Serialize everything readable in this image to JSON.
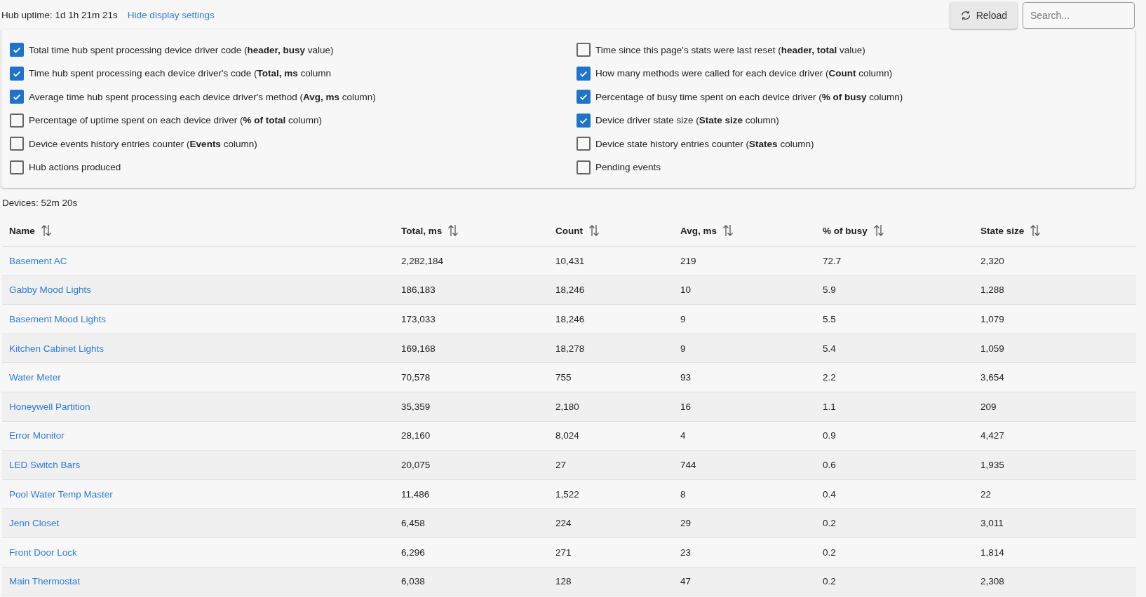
{
  "header": {
    "uptime": "Hub uptime: 1d 1h 21m 21s",
    "toggle_link": "Hide display settings",
    "reload_button": "Reload",
    "search": {
      "placeholder": "Search..."
    }
  },
  "settings": [
    {
      "label": "Total time hub spent processing device driver code (**header, busy** value)",
      "checked": true
    },
    {
      "label": "Time since this page's stats were last reset (**header, total** value)",
      "checked": false
    },
    {
      "label": "Time hub spent processing each device driver's code (**Total, ms** column",
      "checked": true
    },
    {
      "label": "How many methods were called for each device driver (**Count** column)",
      "checked": true
    },
    {
      "label": "Average time hub spent processing each device driver's method (**Avg, ms** column)",
      "checked": true
    },
    {
      "label": "Percentage of busy time spent on each device driver (**% of busy** column)",
      "checked": true
    },
    {
      "label": "Percentage of uptime spent on each device driver (**% of total** column)",
      "checked": false
    },
    {
      "label": "Device driver state size (**State size** column)",
      "checked": true
    },
    {
      "label": "Device events history entries counter (**Events** column)",
      "checked": false
    },
    {
      "label": "Device state history entries counter (**States** column)",
      "checked": false
    },
    {
      "label": "Hub actions produced",
      "checked": false
    },
    {
      "label": "Pending events",
      "checked": false
    }
  ],
  "devices_summary": "Devices: 52m 20s",
  "table": {
    "columns": [
      "Name",
      "Total, ms",
      "Count",
      "Avg, ms",
      "% of busy",
      "State size"
    ],
    "rows": [
      [
        "Basement AC",
        "2,282,184",
        "10,431",
        "219",
        "72.7",
        "2,320"
      ],
      [
        "Gabby Mood Lights",
        "186,183",
        "18,246",
        "10",
        "5.9",
        "1,288"
      ],
      [
        "Basement Mood Lights",
        "173,033",
        "18,246",
        "9",
        "5.5",
        "1,079"
      ],
      [
        "Kitchen Cabinet Lights",
        "169,168",
        "18,278",
        "9",
        "5.4",
        "1,059"
      ],
      [
        "Water Meter",
        "70,578",
        "755",
        "93",
        "2.2",
        "3,654"
      ],
      [
        "Honeywell Partition",
        "35,359",
        "2,180",
        "16",
        "1.1",
        "209"
      ],
      [
        "Error Monitor",
        "28,160",
        "8,024",
        "4",
        "0.9",
        "4,427"
      ],
      [
        "LED Switch Bars",
        "20,075",
        "27",
        "744",
        "0.6",
        "1,935"
      ],
      [
        "Pool Water Temp Master",
        "11,486",
        "1,522",
        "8",
        "0.4",
        "22"
      ],
      [
        "Jenn Closet",
        "6,458",
        "224",
        "29",
        "0.2",
        "3,011"
      ],
      [
        "Front Door Lock",
        "6,296",
        "271",
        "23",
        "0.2",
        "1,814"
      ],
      [
        "Main Thermostat",
        "6,038",
        "128",
        "47",
        "0.2",
        "2,308"
      ]
    ]
  }
}
